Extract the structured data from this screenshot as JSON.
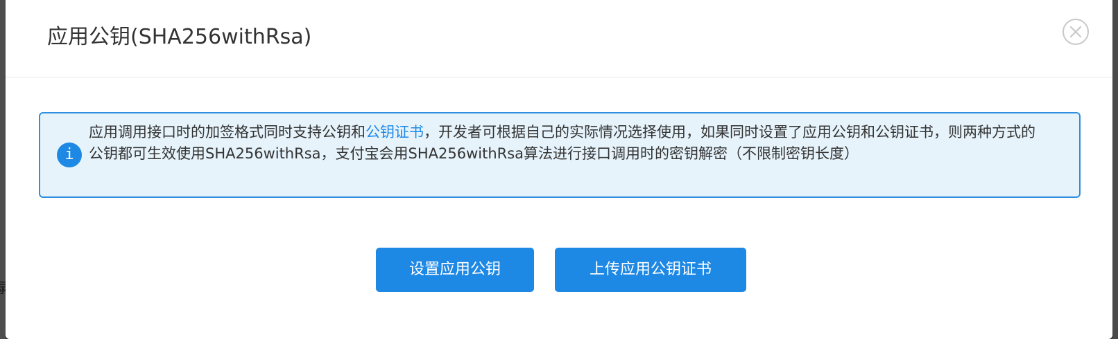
{
  "modal": {
    "title": "应用公钥(SHA256withRsa)",
    "close_icon": "close-icon"
  },
  "alert": {
    "icon": "info-icon",
    "icon_glyph": "i",
    "text_part1": "应用调用接口时的加签格式同时支持公钥和",
    "link_text": "公钥证书",
    "text_part2": "，开发者可根据自己的实际情况选择使用，如果同时设置了应用公钥和公钥证书，则两种方式的公钥都可生效使用SHA256withRsa，支付宝会用SHA256withRsa算法进行接口调用时的密钥解密（不限制密钥长度）"
  },
  "actions": {
    "set_public_key_label": "设置应用公钥",
    "upload_certificate_label": "上传应用公钥证书"
  },
  "colors": {
    "primary": "#1e88e5",
    "alert_background": "#e6f3fb",
    "alert_border": "#2e8fe0",
    "text": "#333333"
  }
}
